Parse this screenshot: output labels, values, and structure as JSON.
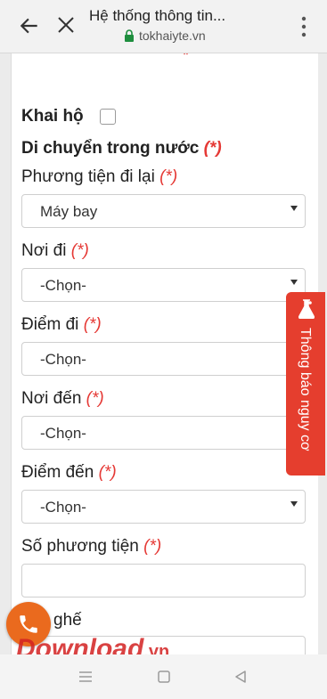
{
  "browser": {
    "title": "Hệ thống thông tin...",
    "url": "tokhaiyte.vn",
    "icons": [
      "back-arrow-icon",
      "close-icon",
      "lock-icon",
      "more-vert-icon"
    ]
  },
  "form": {
    "top_required_mark": "*",
    "khai_ho_label": "Khai hộ",
    "section_title": "Di chuyển trong nước",
    "required_suffix": "(*)",
    "fields": [
      {
        "label": "Phương tiện đi lại",
        "value": "Máy bay",
        "type": "select"
      },
      {
        "label": "Nơi đi",
        "value": "-Chọn-",
        "type": "select"
      },
      {
        "label": "Điểm đi",
        "value": "-Chọn-",
        "type": "select"
      },
      {
        "label": "Nơi đến",
        "value": "-Chọn-",
        "type": "select"
      },
      {
        "label": "Điểm đến",
        "value": "-Chọn-",
        "type": "select"
      },
      {
        "label": "Số phương tiện",
        "value": "",
        "type": "text"
      },
      {
        "label": "ghế",
        "value": "",
        "type": "text"
      }
    ]
  },
  "side_tab": {
    "label": "Thông báo nguy cơ",
    "icon": "flask-icon",
    "color": "#e53e2e"
  },
  "call_button": {
    "icon": "phone-icon",
    "color": "#ea6a1e"
  },
  "watermark": {
    "main": "Download",
    "suffix": ".vn"
  },
  "system_nav": {
    "icons": [
      "menu-icon",
      "home-square-icon",
      "back-triangle-icon"
    ]
  }
}
